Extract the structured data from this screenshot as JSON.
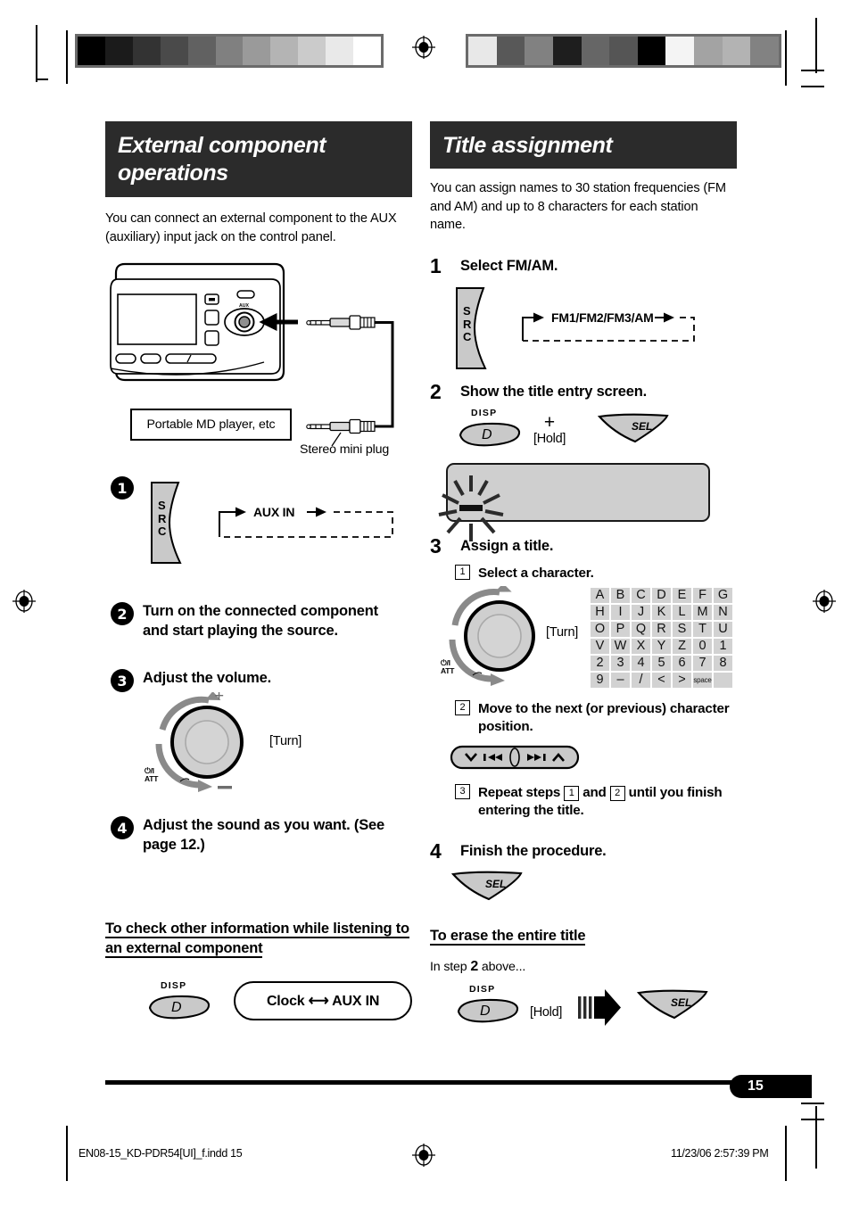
{
  "page": {
    "number": "15",
    "footer_file": "EN08-15_KD-PDR54[UI]_f.indd   15",
    "footer_page": "",
    "footer_timestamp": "11/23/06   2:57:39 PM"
  },
  "calibration": {
    "left_strip": [
      "#000000",
      "#1b1b1b",
      "#333333",
      "#4a4a4a",
      "#616161",
      "#808080",
      "#9a9a9a",
      "#b4b4b4",
      "#cbcbcb",
      "#e9e9e9",
      "#ffffff"
    ],
    "right_strip": [
      "#e8e8e8",
      "#585858",
      "#818181",
      "#1e1e1e",
      "#666666",
      "#555555",
      "#000000",
      "#f4f4f4",
      "#a3a3a3",
      "#b3b3b3",
      "#828282"
    ]
  },
  "left_column": {
    "banner": "External component operations",
    "intro": "You can connect an external component to the AUX (auxiliary) input jack on the control panel.",
    "diagram": {
      "aux_label": "AUX",
      "device_box": "Portable MD player, etc",
      "plug_label": "Stereo mini plug"
    },
    "steps": [
      {
        "marker": "1",
        "text": "",
        "key": "SRC",
        "flow": "AUX IN"
      },
      {
        "marker": "2",
        "text": "Turn on the connected component and start playing the source."
      },
      {
        "marker": "3",
        "text": "Adjust the volume.",
        "knob_turn": "[Turn]",
        "knob_plus": "+",
        "knob_minus": "—",
        "knob_power": "⏻/I",
        "knob_att": "ATT"
      },
      {
        "marker": "4",
        "text": "Adjust the sound as you want. (See page 12.)"
      }
    ],
    "subsection": {
      "heading": "To check other information while listening to an external component",
      "disp_cap": "DISP",
      "disp_glyph": "D",
      "pill": "Clock ⟷ AUX IN"
    }
  },
  "right_column": {
    "banner": "Title assignment",
    "intro": "You can assign names to 30 station frequencies (FM and AM) and up to 8 characters for each station name.",
    "steps": [
      {
        "num": "1",
        "title": "Select FM/AM.",
        "key": "SRC",
        "flow": "FM1/FM2/FM3/AM"
      },
      {
        "num": "2",
        "title": "Show the title entry screen.",
        "disp_cap": "DISP",
        "disp_glyph": "D",
        "plus": "+",
        "hold": "[Hold]",
        "sel_glyph": "SEL"
      },
      {
        "num": "3",
        "title": "Assign a title.",
        "sub": [
          {
            "n": "1",
            "text": "Select a character.",
            "turn": "[Turn]",
            "knob_power": "⏻/I",
            "knob_att": "ATT"
          },
          {
            "n": "2",
            "text": "Move to the next (or previous) character position."
          },
          {
            "n": "3",
            "text_a": "Repeat steps",
            "ref_a": "1",
            "text_b": "and",
            "ref_b": "2",
            "text_c": "until you finish entering the title."
          }
        ],
        "char_table": [
          [
            "A",
            "B",
            "C",
            "D",
            "E",
            "F",
            "G"
          ],
          [
            "H",
            "I",
            "J",
            "K",
            "L",
            "M",
            "N"
          ],
          [
            "O",
            "P",
            "Q",
            "R",
            "S",
            "T",
            "U"
          ],
          [
            "V",
            "W",
            "X",
            "Y",
            "Z",
            "0",
            "1"
          ],
          [
            "2",
            "3",
            "4",
            "5",
            "6",
            "7",
            "8"
          ],
          [
            "9",
            "–",
            "/",
            "<",
            ">",
            "space",
            ""
          ]
        ]
      },
      {
        "num": "4",
        "title": "Finish the procedure.",
        "sel_glyph": "SEL"
      }
    ],
    "erase": {
      "heading": "To erase the entire title",
      "lead_a": "In step",
      "lead_num": "2",
      "lead_b": "above...",
      "disp_cap": "DISP",
      "disp_glyph": "D",
      "hold": "[Hold]",
      "sel_glyph": "SEL"
    }
  }
}
